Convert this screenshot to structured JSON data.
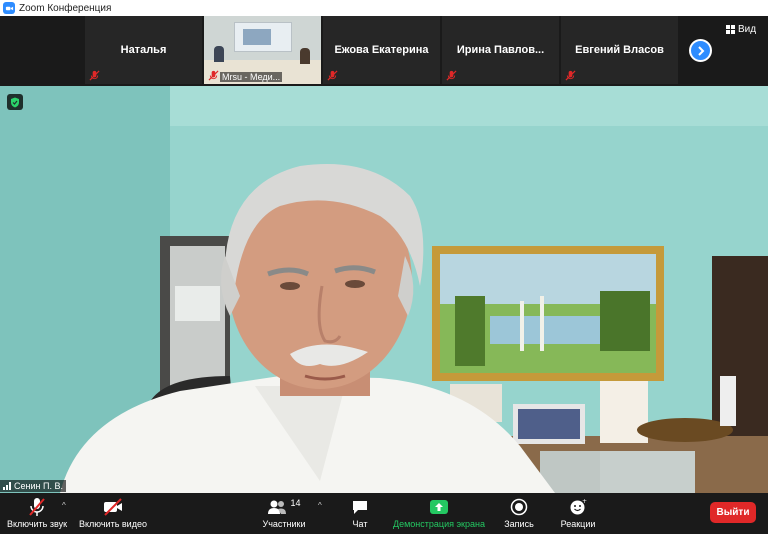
{
  "window": {
    "title": "Zoom Конференция"
  },
  "thumbnails": [
    {
      "name": "Наталья",
      "muted": true
    },
    {
      "name": "Mrsu - Меди...",
      "muted": true,
      "video": true
    },
    {
      "name": "Ежова Екатерина",
      "muted": true
    },
    {
      "name": "Ирина  Павлов...",
      "muted": true
    },
    {
      "name": "Евгений Власов",
      "muted": true
    }
  ],
  "view": {
    "label": "Вид"
  },
  "main_video": {
    "speaker_name": "Сенин П. В."
  },
  "toolbar": {
    "unmute_label": "Включить звук",
    "start_video_label": "Включить видео",
    "participants_label": "Участники",
    "participants_count": "14",
    "chat_label": "Чат",
    "share_label": "Демонстрация экрана",
    "record_label": "Запись",
    "reactions_label": "Реакции",
    "leave_label": "Выйти"
  },
  "colors": {
    "accent": "#2D8CFF",
    "share_green": "#24C862",
    "leave_red": "#E02828",
    "mute_red": "#E02828"
  }
}
